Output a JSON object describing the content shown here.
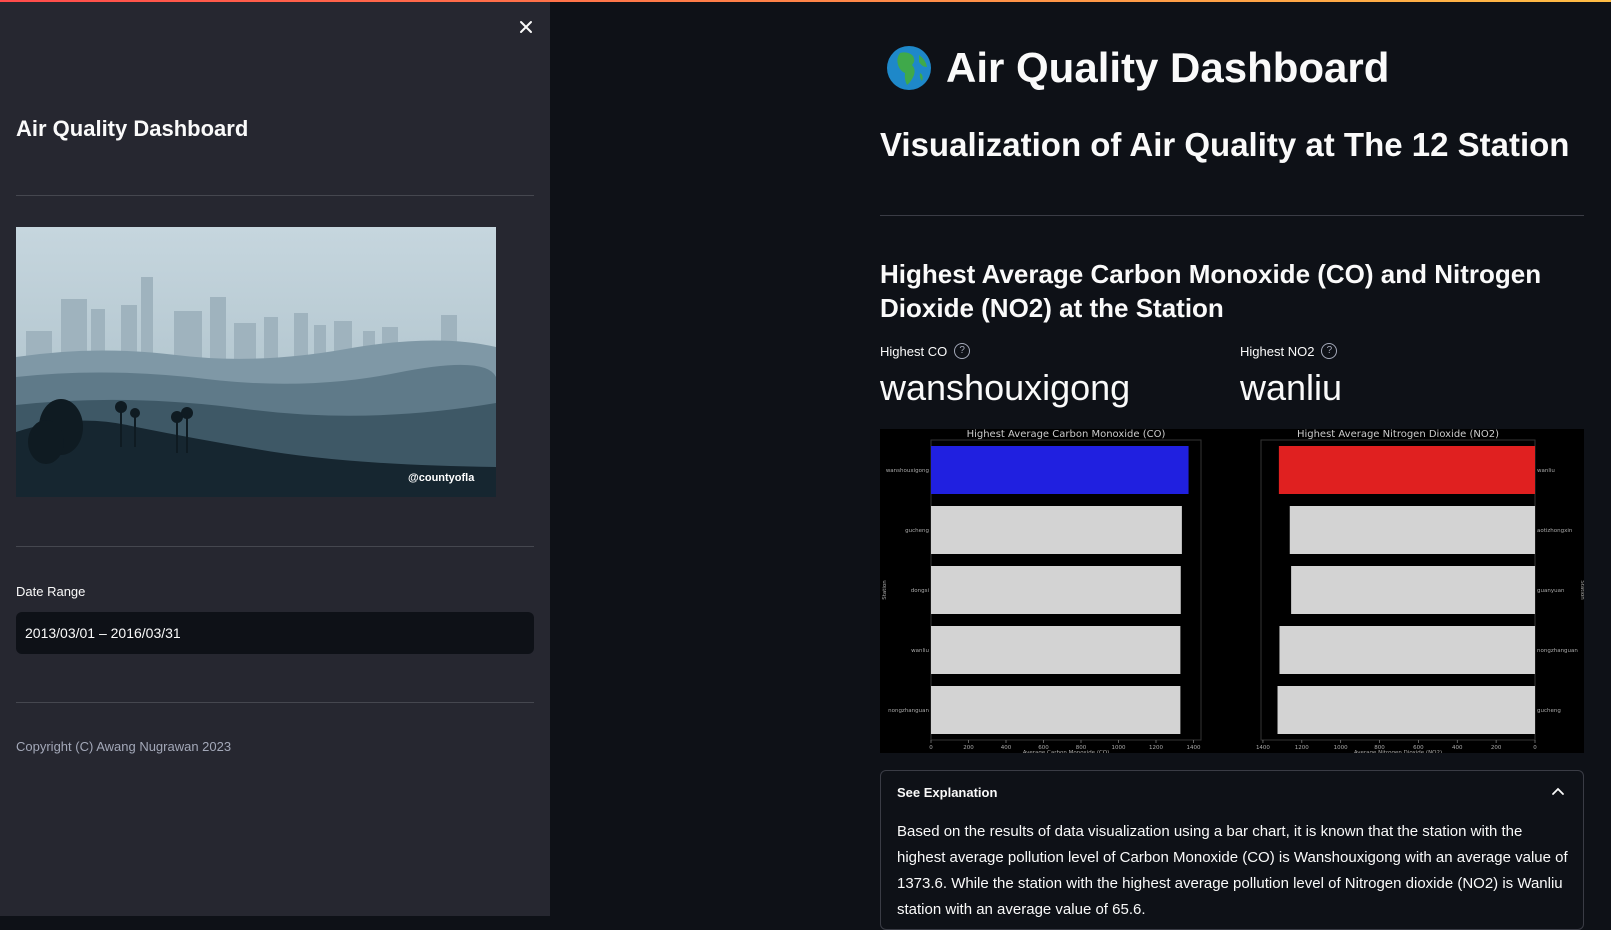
{
  "sidebar": {
    "title": "Air Quality Dashboard",
    "image_caption": "@countyofla",
    "date_label": "Date Range",
    "date_value": "2013/03/01 – 2016/03/31",
    "copyright": "Copyright (C) Awang Nugrawan 2023"
  },
  "main": {
    "title": "Air Quality Dashboard",
    "title_icon": "globe-africa-icon",
    "subtitle": "Visualization of Air Quality at The 12 Station",
    "section_title": "Highest Average Carbon Monoxide (CO) and Nitrogen Dioxide (NO2) at the Station",
    "metrics": [
      {
        "label": "Highest CO",
        "value": "wanshouxigong"
      },
      {
        "label": "Highest NO2",
        "value": "wanliu"
      }
    ],
    "expander": {
      "label": "See Explanation",
      "text": "Based on the results of data visualization using a bar chart, it is known that the station with the highest average pollution level of Carbon Monoxide (CO) is Wanshouxigong with an average value of 1373.6. While the station with the highest average pollution level of Nitrogen dioxide (NO2) is Wanliu station with an average value of 65.6."
    }
  },
  "colors": {
    "accent_top": "#ff4b4b",
    "co_highlight": "#2020e0",
    "no2_highlight": "#e02020",
    "bar_default": "#d3d3d3"
  },
  "chart_data": [
    {
      "type": "bar",
      "orientation": "horizontal",
      "title": "Highest Average Carbon Monoxide (CO)",
      "xlabel": "Average Carbon Monoxide (CO)",
      "ylabel": "Station",
      "categories": [
        "wanshouxigong",
        "gucheng",
        "dongsi",
        "wanliu",
        "nongzhanguan"
      ],
      "values": [
        1373.6,
        1338,
        1332,
        1330,
        1330
      ],
      "xlim": [
        0,
        1440
      ],
      "xticks": [
        0,
        200,
        400,
        600,
        800,
        1000,
        1200,
        1400
      ],
      "x_reversed": false,
      "y_label_side": "left",
      "highlight_color": "#2020e0"
    },
    {
      "type": "bar",
      "orientation": "horizontal",
      "title": "Highest Average Nitrogen Dioxide (NO2)",
      "xlabel": "Average Nitrogen Dioxide (NO2)",
      "ylabel": "Station",
      "categories": [
        "wanliu",
        "aotizhongxin",
        "guanyuan",
        "nongzhanguan",
        "gucheng"
      ],
      "values": [
        1318,
        1262,
        1255,
        1315,
        1325
      ],
      "xlim": [
        0,
        1410
      ],
      "xticks": [
        0,
        200,
        400,
        600,
        800,
        1000,
        1200,
        1400
      ],
      "x_reversed": true,
      "y_label_side": "right",
      "highlight_color": "#e02020"
    }
  ]
}
